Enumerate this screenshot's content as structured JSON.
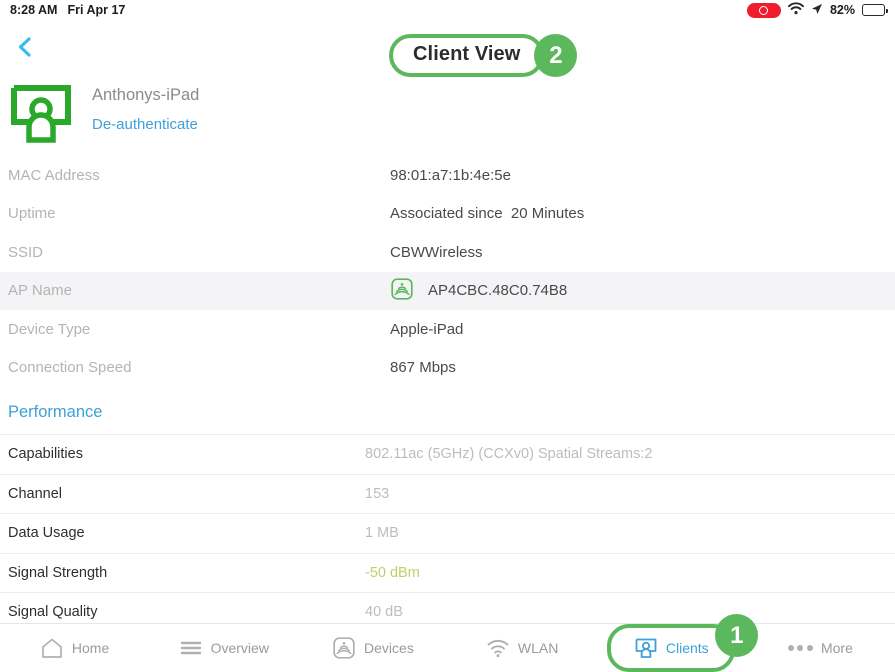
{
  "statusbar": {
    "time": "8:28 AM",
    "date": "Fri Apr 17",
    "battery_percent": "82%",
    "record_icon": "record-indicator-icon",
    "wifi_icon": "wifi-icon",
    "location_icon": "location-arrow-icon",
    "battery_icon": "battery-icon"
  },
  "nav": {
    "back_icon": "back-chevron-icon",
    "title": "Client View",
    "title_badge": "2"
  },
  "client": {
    "avatar_icon": "client-device-avatar-icon",
    "name": "Anthonys-iPad",
    "deauthenticate_label": "De-authenticate"
  },
  "details": [
    {
      "label": "MAC Address",
      "value": "98:01:a7:1b:4e:5e",
      "highlight": false,
      "icon": ""
    },
    {
      "label": "Uptime",
      "value": "Associated since  20 Minutes",
      "highlight": false,
      "icon": ""
    },
    {
      "label": "SSID",
      "value": "CBWWireless",
      "highlight": false,
      "icon": ""
    },
    {
      "label": "AP Name",
      "value": "AP4CBC.48C0.74B8",
      "highlight": true,
      "icon": "access-point-icon"
    },
    {
      "label": "Device Type",
      "value": "Apple-iPad",
      "highlight": false,
      "icon": ""
    },
    {
      "label": "Connection Speed",
      "value": "867 Mbps",
      "highlight": false,
      "icon": ""
    }
  ],
  "performance": {
    "title": "Performance",
    "rows": [
      {
        "label": "Capabilities",
        "value": "802.11ac (5GHz) (CCXv0) Spatial Streams:2",
        "accent": false
      },
      {
        "label": "Channel",
        "value": "153",
        "accent": false
      },
      {
        "label": "Data Usage",
        "value": "1 MB",
        "accent": false
      },
      {
        "label": "Signal Strength",
        "value": "-50 dBm",
        "accent": true
      },
      {
        "label": "Signal Quality",
        "value": "40 dB",
        "accent": false
      }
    ]
  },
  "tabbar": {
    "badge": "1",
    "tabs": [
      {
        "label": "Home",
        "icon": "home-icon",
        "active": false
      },
      {
        "label": "Overview",
        "icon": "menu-lines-icon",
        "active": false
      },
      {
        "label": "Devices",
        "icon": "access-point-icon",
        "active": false
      },
      {
        "label": "WLAN",
        "icon": "wifi-icon",
        "active": false
      },
      {
        "label": "Clients",
        "icon": "clients-icon",
        "active": true
      },
      {
        "label": "More",
        "icon": "ellipsis-icon",
        "active": false
      }
    ]
  },
  "colors": {
    "annotation_green": "#5cb85c",
    "link_blue": "#3ea0d8",
    "signal_accent": "#c5cc6b",
    "highlight_row": "#f4f4f6"
  }
}
